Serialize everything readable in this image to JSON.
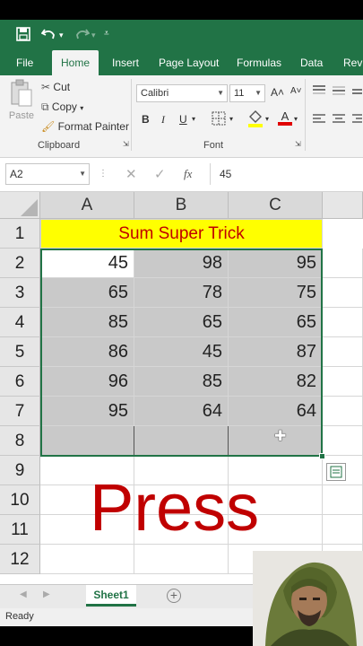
{
  "quick_access": {
    "save_icon": "save-icon",
    "undo_icon": "undo-icon",
    "redo_icon": "redo-icon",
    "customize_icon": "customize-icon"
  },
  "tabs": [
    "File",
    "Home",
    "Insert",
    "Page Layout",
    "Formulas",
    "Data",
    "Revi"
  ],
  "clipboard": {
    "paste": "Paste",
    "cut": "Cut",
    "copy": "Copy",
    "format_painter": "Format Painter",
    "group_label": "Clipboard"
  },
  "font": {
    "name": "Calibri",
    "size": "11",
    "bold": "B",
    "italic": "I",
    "underline": "U",
    "grow": "A˄",
    "shrink": "A˅",
    "font_color": "A",
    "group_label": "Font"
  },
  "formula_bar": {
    "name_box": "A2",
    "fx": "fx",
    "value": "45"
  },
  "columns": [
    "A",
    "B",
    "C"
  ],
  "rows": [
    "1",
    "2",
    "3",
    "4",
    "5",
    "6",
    "7",
    "8",
    "9",
    "10",
    "11",
    "12"
  ],
  "title_cell": "Sum Super Trick",
  "table": [
    [
      "45",
      "98",
      "95"
    ],
    [
      "65",
      "78",
      "75"
    ],
    [
      "85",
      "65",
      "65"
    ],
    [
      "86",
      "45",
      "87"
    ],
    [
      "96",
      "85",
      "82"
    ],
    [
      "95",
      "64",
      "64"
    ]
  ],
  "overlay_text": "Press",
  "sheet_tab": "Sheet1",
  "status": "Ready",
  "colors": {
    "excel_green": "#217346",
    "title_fill": "#ffff00",
    "title_text": "#c00000",
    "overlay": "#c00000"
  }
}
